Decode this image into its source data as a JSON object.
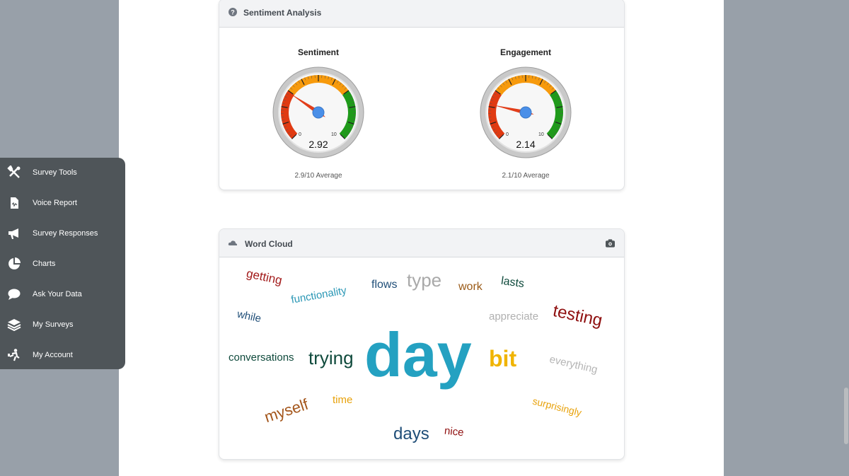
{
  "sentiment_card": {
    "title": "Sentiment Analysis",
    "gauges": [
      {
        "title": "Sentiment",
        "value": "2.92",
        "min_label": "0",
        "max_label": "10",
        "average": "2.9/10 Average",
        "level": 2.92
      },
      {
        "title": "Engagement",
        "value": "2.14",
        "min_label": "0",
        "max_label": "10",
        "average": "2.1/10 Average",
        "level": 2.14
      }
    ]
  },
  "word_cloud_card": {
    "title": "Word Cloud",
    "words": [
      {
        "text": "getting",
        "color": "#a31c1c"
      },
      {
        "text": "flows",
        "color": "#1f4e78"
      },
      {
        "text": "type",
        "color": "#a9a9a9"
      },
      {
        "text": "work",
        "color": "#9a5a17"
      },
      {
        "text": "lasts",
        "color": "#0f4a3c"
      },
      {
        "text": "functionality",
        "color": "#2a97b5"
      },
      {
        "text": "while",
        "color": "#1f4e78"
      },
      {
        "text": "appreciate",
        "color": "#b0b0b0"
      },
      {
        "text": "testing",
        "color": "#8f0f0f"
      },
      {
        "text": "conversations",
        "color": "#0f4a3c"
      },
      {
        "text": "trying",
        "color": "#0f4a3c"
      },
      {
        "text": "day",
        "color": "#24a1c1"
      },
      {
        "text": "bit",
        "color": "#f0b400"
      },
      {
        "text": "everything",
        "color": "#b5b5b5"
      },
      {
        "text": "time",
        "color": "#e8a20c"
      },
      {
        "text": "myself",
        "color": "#a4561b"
      },
      {
        "text": "surprisingly",
        "color": "#e8a20c"
      },
      {
        "text": "days",
        "color": "#1f4e78"
      },
      {
        "text": "nice",
        "color": "#8f0f0f"
      }
    ]
  },
  "sidebar": {
    "items": [
      {
        "label": "Survey Tools",
        "icon": "tools-icon"
      },
      {
        "label": "Voice Report",
        "icon": "voice-report-icon"
      },
      {
        "label": "Survey Responses",
        "icon": "megaphone-icon"
      },
      {
        "label": "Charts",
        "icon": "pie-chart-icon"
      },
      {
        "label": "Ask Your Data",
        "icon": "chat-bubble-icon"
      },
      {
        "label": "My Surveys",
        "icon": "layers-icon"
      },
      {
        "label": "My Account",
        "icon": "account-icon"
      }
    ]
  },
  "colors": {
    "gauge_red": "#e03a12",
    "gauge_orange": "#f79a0c",
    "gauge_green": "#1f9a1a",
    "needle": "#e23e1a",
    "hub": "#4a8fe8",
    "sidebar_bg": "#4f5559"
  }
}
